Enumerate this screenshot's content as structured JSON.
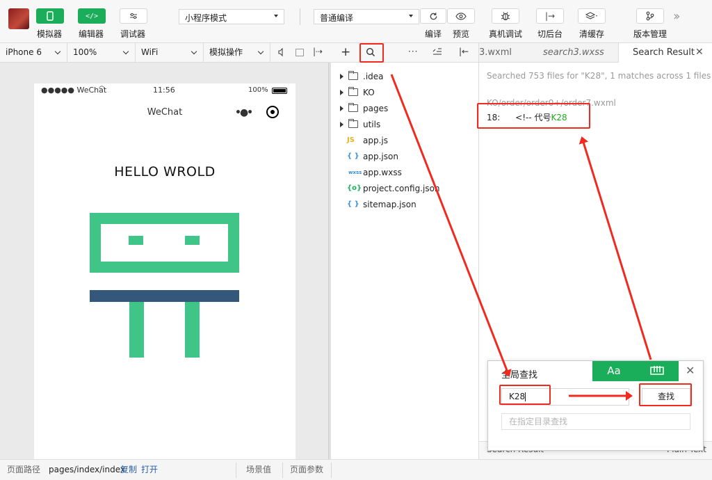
{
  "toolbar": {
    "simulator_label": "模拟器",
    "editor_label": "编辑器",
    "debugger_label": "调试器",
    "mode_select": "小程序模式",
    "compile_select": "普通编译",
    "compile_label": "编译",
    "preview_label": "预览",
    "real_debug_label": "真机调试",
    "switch_bg_label": "切后台",
    "clear_cache_label": "清缓存",
    "version_label": "版本管理"
  },
  "subbar": {
    "device": "iPhone 6",
    "zoom": "100%",
    "network": "WiFi",
    "operation": "模拟操作"
  },
  "phone": {
    "signal": "●●●●● WeChat",
    "time": "11:56",
    "battery_pct": "100%",
    "nav_title": "WeChat",
    "headline": "HELLO WROLD"
  },
  "explorer": {
    "items": [
      {
        "name": ".idea",
        "kind": "folder"
      },
      {
        "name": "KO",
        "kind": "folder"
      },
      {
        "name": "pages",
        "kind": "folder"
      },
      {
        "name": "utils",
        "kind": "folder"
      },
      {
        "name": "app.js",
        "kind": "js",
        "icon": "JS"
      },
      {
        "name": "app.json",
        "kind": "json",
        "icon": "{ }"
      },
      {
        "name": "app.wxss",
        "kind": "wxss",
        "icon": "wxss"
      },
      {
        "name": "project.config.json",
        "kind": "config",
        "icon": "{o}"
      },
      {
        "name": "sitemap.json",
        "kind": "json",
        "icon": "{ }"
      }
    ]
  },
  "tabs": {
    "tab1": "3.wxml",
    "tab2": "search3.wxss",
    "tab3": "Search Result"
  },
  "search_result": {
    "summary": "Searched 753 files for \"K28\", 1 matches across 1 files",
    "file_path": "KO/order/order0+/order7.wxml",
    "line_no": "18:",
    "line_prefix": "<!-- 代号",
    "line_match": "K28",
    "bottom_left": "Search Result",
    "bottom_right": "Plain Text"
  },
  "find_dialog": {
    "title": "全局查找",
    "case_label": "Aa",
    "query": "K28",
    "find_button": "查找",
    "dir_placeholder": "在指定目录查找"
  },
  "statusbar": {
    "path_label": "页面路径",
    "path_value": "pages/index/index",
    "copy_link": "复制",
    "open_link": "打开",
    "scene_value": "场景值",
    "page_params": "页面参数"
  },
  "colors": {
    "brand_green": "#1aad5a",
    "illustration_green": "#40c589",
    "illustration_navy": "#34587a",
    "annotation_red": "#f02a1f",
    "match_green": "#1aad19"
  }
}
